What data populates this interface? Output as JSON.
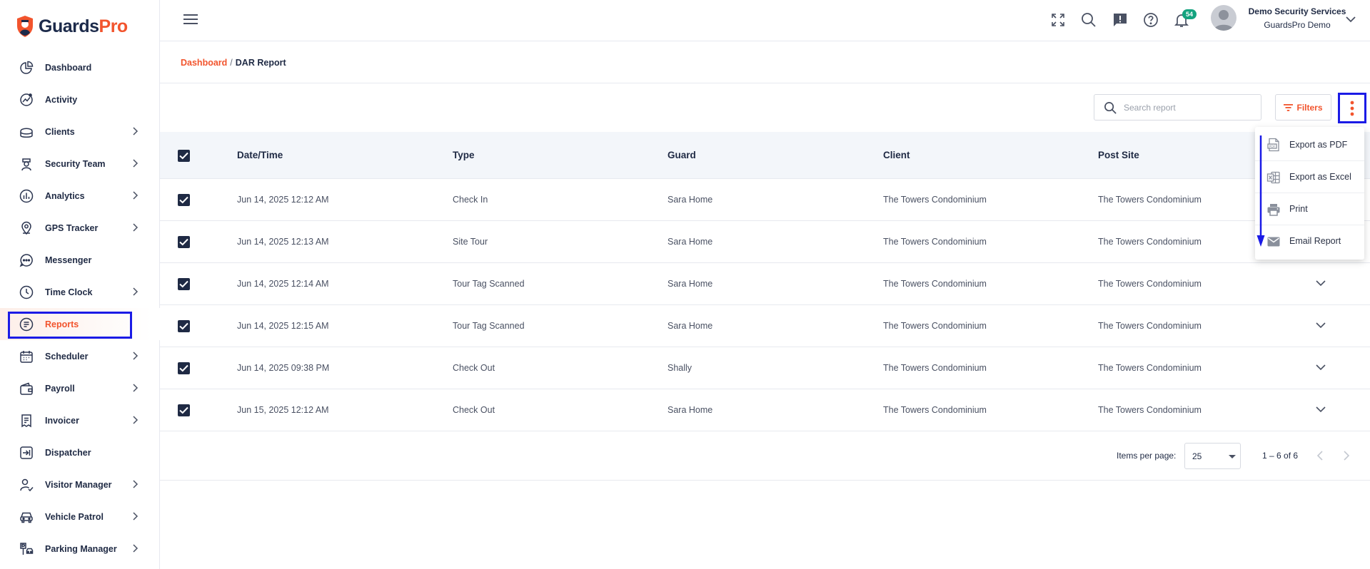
{
  "app": {
    "logo_part1": "Guards",
    "logo_part2": "Pro"
  },
  "sidebar": {
    "items": [
      {
        "label": "Dashboard",
        "icon": "dashboard-icon",
        "chevron": false
      },
      {
        "label": "Activity",
        "icon": "activity-icon",
        "chevron": false
      },
      {
        "label": "Clients",
        "icon": "clients-icon",
        "chevron": true
      },
      {
        "label": "Security Team",
        "icon": "security-team-icon",
        "chevron": true
      },
      {
        "label": "Analytics",
        "icon": "analytics-icon",
        "chevron": true
      },
      {
        "label": "GPS Tracker",
        "icon": "gps-pin-icon",
        "chevron": true
      },
      {
        "label": "Messenger",
        "icon": "messenger-icon",
        "chevron": false
      },
      {
        "label": "Time Clock",
        "icon": "clock-icon",
        "chevron": true
      },
      {
        "label": "Reports",
        "icon": "reports-icon",
        "chevron": false,
        "active": true
      },
      {
        "label": "Scheduler",
        "icon": "calendar-icon",
        "chevron": true
      },
      {
        "label": "Payroll",
        "icon": "wallet-icon",
        "chevron": true
      },
      {
        "label": "Invoicer",
        "icon": "invoice-icon",
        "chevron": true
      },
      {
        "label": "Dispatcher",
        "icon": "dispatch-icon",
        "chevron": false
      },
      {
        "label": "Visitor Manager",
        "icon": "visitor-icon",
        "chevron": true
      },
      {
        "label": "Vehicle Patrol",
        "icon": "car-icon",
        "chevron": true
      },
      {
        "label": "Parking Manager",
        "icon": "parking-icon",
        "chevron": true
      }
    ]
  },
  "header": {
    "notification_count": "54",
    "company": "Demo Security Services",
    "user": "GuardsPro Demo"
  },
  "breadcrumb": {
    "root": "Dashboard",
    "separator": "/",
    "current": "DAR Report"
  },
  "toolbar": {
    "search_placeholder": "Search report",
    "filters_label": "Filters"
  },
  "table": {
    "columns": [
      "Date/Time",
      "Type",
      "Guard",
      "Client",
      "Post Site"
    ],
    "rows": [
      [
        "Jun 14, 2025 12:12 AM",
        "Check In",
        "Sara Home",
        "The Towers Condominium",
        "The Towers Condominium"
      ],
      [
        "Jun 14, 2025 12:13 AM",
        "Site Tour",
        "Sara Home",
        "The Towers Condominium",
        "The Towers Condominium"
      ],
      [
        "Jun 14, 2025 12:14 AM",
        "Tour Tag Scanned",
        "Sara Home",
        "The Towers Condominium",
        "The Towers Condominium"
      ],
      [
        "Jun 14, 2025 12:15 AM",
        "Tour Tag Scanned",
        "Sara Home",
        "The Towers Condominium",
        "The Towers Condominium"
      ],
      [
        "Jun 14, 2025 09:38 PM",
        "Check Out",
        "Shally",
        "The Towers Condominium",
        "The Towers Condominium"
      ],
      [
        "Jun 15, 2025 12:12 AM",
        "Check Out",
        "Sara Home",
        "The Towers Condominium",
        "The Towers Condominium"
      ]
    ]
  },
  "pagination": {
    "items_per_page_label": "Items per page:",
    "items_per_page": "25",
    "range": "1 – 6 of 6"
  },
  "menu": {
    "items": [
      {
        "label": "Export as PDF",
        "icon": "pdf-file-icon"
      },
      {
        "label": "Export as Excel",
        "icon": "excel-file-icon"
      },
      {
        "label": "Print",
        "icon": "printer-icon"
      },
      {
        "label": "Email Report",
        "icon": "envelope-icon"
      }
    ]
  },
  "colors": {
    "accent": "#f2542d",
    "navy": "#1f2a44",
    "annotation": "#1b1be6",
    "badge": "#14a37f"
  }
}
